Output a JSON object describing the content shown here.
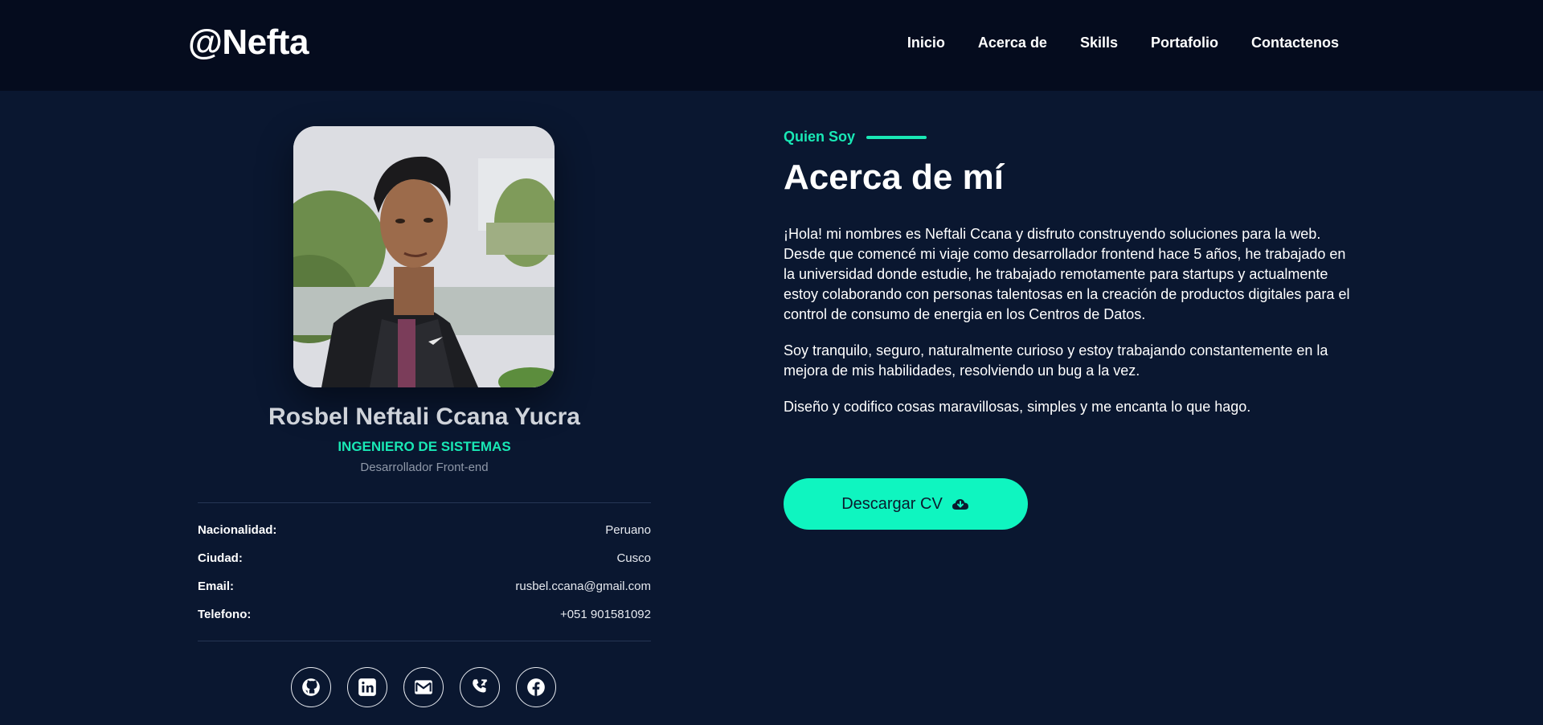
{
  "header": {
    "brand": "@Nefta",
    "nav": [
      "Inicio",
      "Acerca de",
      "Skills",
      "Portafolio",
      "Contactenos"
    ]
  },
  "profile": {
    "name": "Rosbel Neftali Ccana Yucra",
    "title": "INGENIERO DE SISTEMAS",
    "role": "Desarrollador Front-end",
    "info": [
      {
        "label": "Nacionalidad:",
        "value": "Peruano"
      },
      {
        "label": "Ciudad:",
        "value": "Cusco"
      },
      {
        "label": "Email:",
        "value": "rusbel.ccana@gmail.com"
      },
      {
        "label": "Telefono:",
        "value": "+051 901581092"
      }
    ],
    "socials": [
      "github-icon",
      "linkedin-icon",
      "mail-icon",
      "phone-icon",
      "facebook-icon"
    ]
  },
  "about": {
    "eyebrow": "Quien Soy",
    "heading": "Acerca de mí",
    "paragraphs": [
      "¡Hola! mi nombres es Neftali Ccana y disfruto construyendo soluciones para la web. Desde que comencé mi viaje como desarrollador frontend hace 5 años, he trabajado en la universidad donde estudie, he trabajado remotamente para startups y actualmente estoy colaborando con personas talentosas en la creación de productos digitales para el control de consumo de energia en los Centros de Datos.",
      "Soy tranquilo, seguro, naturalmente curioso y estoy trabajando constantemente en la mejora de mis habilidades, resolviendo un bug a la vez.",
      "Diseño y codifico cosas maravillosas, simples y me encanta lo que hago."
    ],
    "cv_button": "Descargar CV"
  },
  "colors": {
    "background": "#0a1730",
    "navbar": "#050c1e",
    "accent": "#19e8b5",
    "button": "#0ff5c0"
  }
}
